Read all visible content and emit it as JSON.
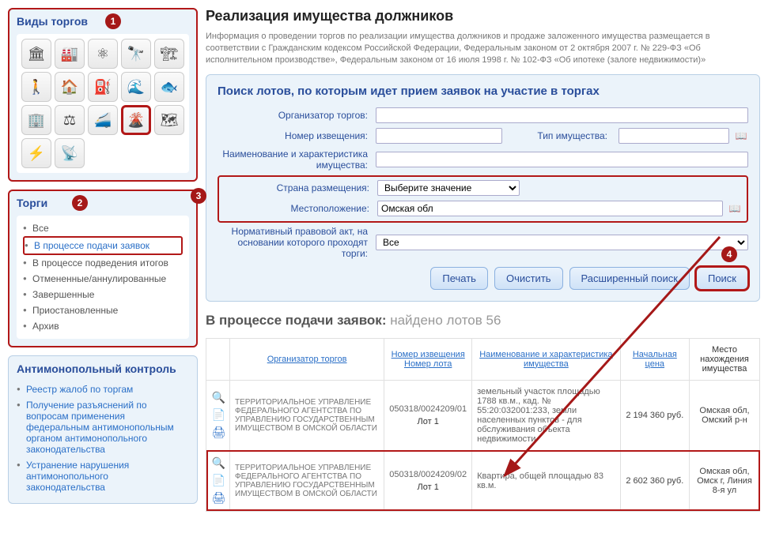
{
  "sidebar": {
    "auctionTypes": {
      "title": "Виды торгов",
      "bubble": "1",
      "icons": [
        "🏛",
        "🏭",
        "⚛",
        "🔭",
        "🏗",
        "🚶",
        "🏠",
        "⛽",
        "🌊",
        "🐟",
        "🏢",
        "⚖",
        "🚄",
        "🌋",
        "🗺",
        "⚡",
        "📡"
      ]
    },
    "auctions": {
      "title": "Торги",
      "bubble": "2",
      "items": [
        {
          "label": "Все",
          "sel": false
        },
        {
          "label": "В процессе подачи заявок",
          "sel": true
        },
        {
          "label": "В процессе подведения итогов",
          "sel": false
        },
        {
          "label": "Отмененные/аннулированные",
          "sel": false
        },
        {
          "label": "Завершенные",
          "sel": false
        },
        {
          "label": "Приостановленные",
          "sel": false
        },
        {
          "label": "Архив",
          "sel": false
        }
      ]
    },
    "anti": {
      "title": "Антимонопольный контроль",
      "items": [
        {
          "label": "Реестр жалоб по торгам"
        },
        {
          "label": "Получение разъяснений по вопросам применения федеральным антимонопольным органом антимонопольного законодательства"
        },
        {
          "label": "Устранение нарушения антимонопольного законодательства"
        }
      ]
    }
  },
  "page": {
    "title": "Реализация имущества должников",
    "intro": "Информация о проведении торгов по реализации имущества должников и продаже заложенного имущества размещается в соответствии с Гражданским кодексом Российской Федерации, Федеральным законом от 2 октября 2007 г. № 229-ФЗ «Об исполнительном производстве», Федеральным законом от 16 июля 1998 г. № 102-ФЗ «Об ипотеке (залоге недвижимости)»"
  },
  "search": {
    "title": "Поиск лотов, по которым идет прием заявок на участие в торгах",
    "bubble3": "3",
    "bubble4": "4",
    "labels": {
      "organizer": "Организатор торгов:",
      "notice": "Номер извещения:",
      "propType": "Тип имущества:",
      "propName": "Наименование и характеристика имущества:",
      "country": "Страна размещения:",
      "location": "Местоположение:",
      "norm": "Нормативный правовой акт, на основании которого проходят торги:"
    },
    "values": {
      "organizer": "",
      "notice": "",
      "propType": "",
      "propName": "",
      "country": "Выберите значение",
      "location": "Омская обл",
      "norm": "Все"
    },
    "buttons": {
      "print": "Печать",
      "clear": "Очистить",
      "advanced": "Расширенный поиск",
      "search": "Поиск"
    }
  },
  "results": {
    "header_prefix": "В процессе подачи заявок:",
    "header_suffix": "найдено лотов 56",
    "columns": {
      "tools": "",
      "organizer": "Организатор торгов",
      "notice": "Номер извещения",
      "lot": "Номер лота",
      "desc": "Наименование и характеристика имущества",
      "price": "Начальная цена",
      "loc": "Место нахождения имущества"
    },
    "rows": [
      {
        "org": "ТЕРРИТОРИАЛЬНОЕ УПРАВЛЕНИЕ ФЕДЕРАЛЬНОГО АГЕНТСТВА ПО УПРАВЛЕНИЮ ГОСУДАРСТВЕННЫМ ИМУЩЕСТВОМ В ОМСКОЙ ОБЛАСТИ",
        "notice": "050318/0024209/01",
        "lot": "Лот 1",
        "desc": "земельный участок площадью 1788 кв.м., кад. № 55:20:032001:233, земли населенных пунктов - для обслуживания объекта недвижимости",
        "price": "2 194 360 руб.",
        "loc": "Омская обл, Омский р-н",
        "hl": false
      },
      {
        "org": "ТЕРРИТОРИАЛЬНОЕ УПРАВЛЕНИЕ ФЕДЕРАЛЬНОГО АГЕНТСТВА ПО УПРАВЛЕНИЮ ГОСУДАРСТВЕННЫМ ИМУЩЕСТВОМ В ОМСКОЙ ОБЛАСТИ",
        "notice": "050318/0024209/02",
        "lot": "Лот 1",
        "desc": "Квартира, общей площадью 83 кв.м.",
        "price": "2 602 360 руб.",
        "loc": "Омская обл, Омск г, Линия 8-я ул",
        "hl": true
      }
    ]
  }
}
